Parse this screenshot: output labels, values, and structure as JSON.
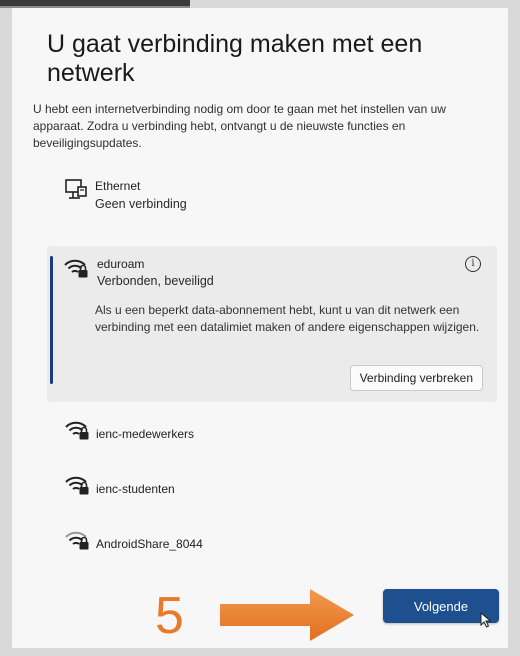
{
  "page": {
    "title": "U gaat verbinding maken met een netwerk",
    "description": "U hebt een internetverbinding nodig om door te gaan met het instellen van uw apparaat. Zodra u verbinding hebt, ontvangt u de nieuwste functies en beveiligingsupdates."
  },
  "networks": {
    "ethernet": {
      "name": "Ethernet",
      "status": "Geen verbinding",
      "icon": "ethernet-icon"
    },
    "connected": {
      "name": "eduroam",
      "status": "Verbonden, beveiligd",
      "icon": "wifi-secured-icon",
      "note": "Als u een beperkt data-abonnement hebt, kunt u van dit netwerk een verbinding met een datalimiet maken of andere eigenschappen wijzigen.",
      "disconnect_label": "Verbinding verbreken"
    },
    "list": [
      {
        "name": "ienc-medewerkers",
        "icon": "wifi-secured-icon"
      },
      {
        "name": "ienc-studenten",
        "icon": "wifi-secured-icon"
      },
      {
        "name": "AndroidShare_8044",
        "icon": "wifi-secured-weak-icon"
      }
    ]
  },
  "annotation": {
    "step": "5",
    "color": "#e87a2a"
  },
  "footer": {
    "next_label": "Volgende",
    "accent": "#1e4f8f"
  }
}
